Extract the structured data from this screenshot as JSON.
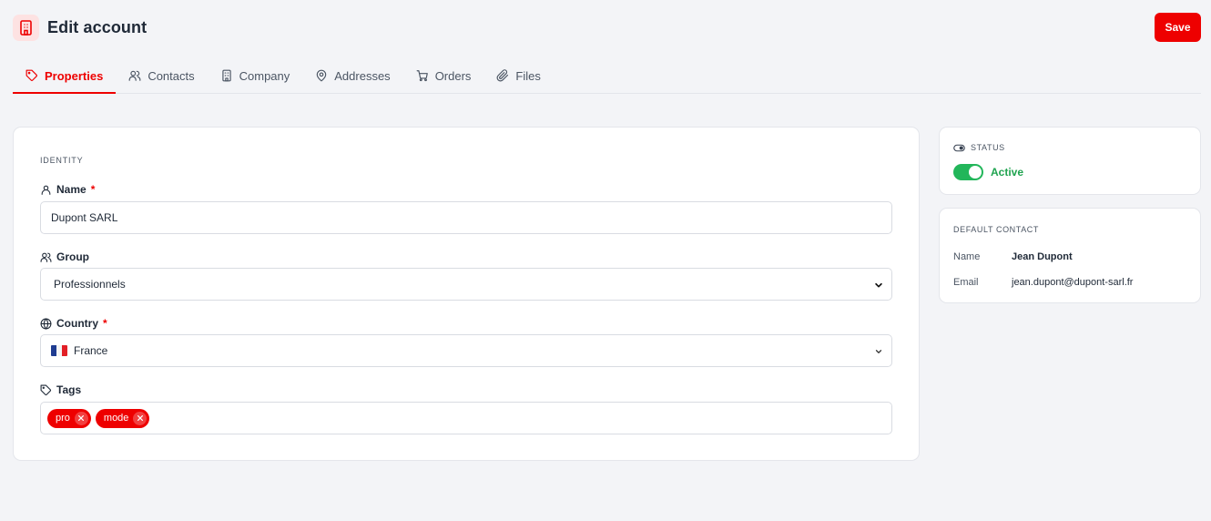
{
  "header": {
    "title": "Edit account",
    "save_label": "Save",
    "app_icon": "building-icon"
  },
  "tabs": [
    {
      "label": "Properties",
      "icon": "tag-icon",
      "active": true
    },
    {
      "label": "Contacts",
      "icon": "users-icon",
      "active": false
    },
    {
      "label": "Company",
      "icon": "building-icon",
      "active": false
    },
    {
      "label": "Addresses",
      "icon": "map-pin-icon",
      "active": false
    },
    {
      "label": "Orders",
      "icon": "cart-icon",
      "active": false
    },
    {
      "label": "Files",
      "icon": "paperclip-icon",
      "active": false
    }
  ],
  "identity": {
    "section_title": "IDENTITY",
    "name": {
      "label": "Name",
      "required": "*",
      "value": "Dupont SARL"
    },
    "group": {
      "label": "Group",
      "value": "Professionnels"
    },
    "country": {
      "label": "Country",
      "required": "*",
      "value": "France"
    },
    "tags": {
      "label": "Tags",
      "items": [
        "pro",
        "mode"
      ]
    }
  },
  "status": {
    "title": "STATUS",
    "value": "Active",
    "enabled": true
  },
  "default_contact": {
    "title": "DEFAULT CONTACT",
    "name_label": "Name",
    "name_value": "Jean Dupont",
    "email_label": "Email",
    "email_value": "jean.dupont@dupont-sarl.fr"
  },
  "colors": {
    "accent": "#ee0000",
    "success": "#22b65a",
    "background": "#f3f4f7"
  }
}
